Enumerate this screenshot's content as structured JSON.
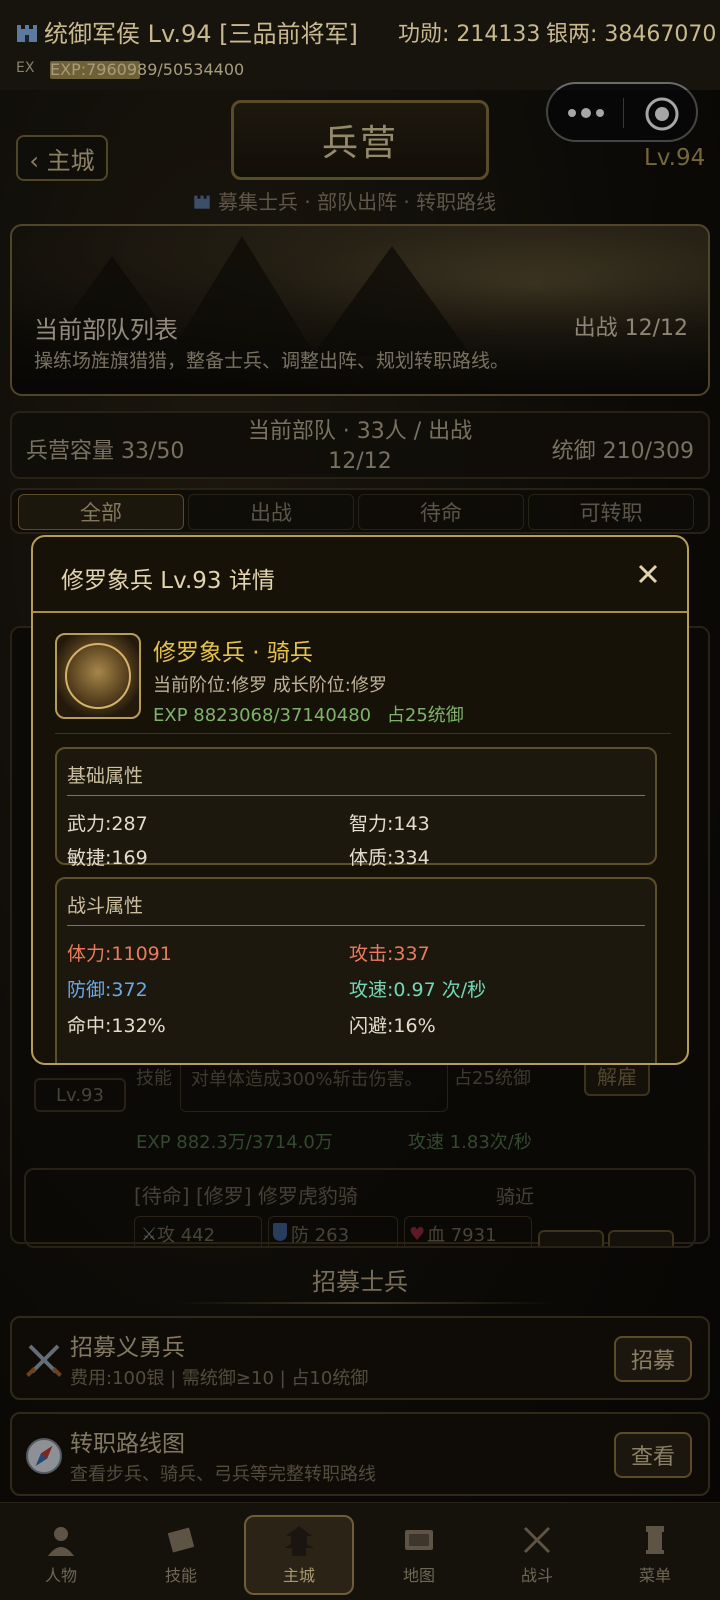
{
  "status": {
    "title": "统御军侯 Lv.94 [三品前将军]",
    "merit": "功勋: 214133",
    "silver": "银两: 38467070",
    "ex_label": "EX",
    "exp_text": "EXP:7960989/50534400",
    "exp_progress": 0.158
  },
  "header": {
    "back_label": "‹ 主城",
    "title": "兵营",
    "level": "Lv.94",
    "subtitle": "募集士兵 · 部队出阵 · 转职路线"
  },
  "banner": {
    "title": "当前部队列表",
    "deploy": "出战 12/12",
    "desc": "操练场旌旗猎猎，整备士兵、调整出阵、规划转职路线。"
  },
  "capacity": {
    "barracks": "兵营容量 33/50",
    "current": "当前部队 · 33人 / 出战12/12",
    "command": "统御 210/309"
  },
  "tabs": [
    "全部",
    "出战",
    "待命",
    "可转职"
  ],
  "list": {
    "card2": {
      "level": "Lv.93",
      "skill_label": "技能",
      "skill_text": "对单体造成300%斩击伤害。",
      "occupy": "占25统御",
      "disband": "解雇",
      "exp": "EXP 882.3万/3714.0万",
      "speed": "攻速 1.83次/秒"
    },
    "card3": {
      "title": "[待命] [修罗] 修罗虎豹骑",
      "role": "骑近",
      "atk": "攻 442",
      "def": "防 263",
      "hp": "血 7931"
    }
  },
  "recruit": {
    "heading": "招募士兵",
    "militia": {
      "title": "招募义勇兵",
      "desc": "费用:100银 | 需统御≥10 | 占10统御",
      "button": "招募"
    },
    "route": {
      "title": "转职路线图",
      "desc": "查看步兵、骑兵、弓兵等完整转职路线",
      "button": "查看"
    }
  },
  "nav": [
    "人物",
    "技能",
    "主城",
    "地图",
    "战斗",
    "菜单"
  ],
  "modal": {
    "title": "修罗象兵 Lv.93 详情",
    "unit_name": "修罗象兵 · 骑兵",
    "tier": "当前阶位:修罗  成长阶位:修罗",
    "exp": "EXP 8823068/37140480",
    "occupy": "占25统御",
    "basic": {
      "header": "基础属性",
      "str": "武力:287",
      "int": "智力:143",
      "agi": "敏捷:169",
      "con": "体质:334"
    },
    "combat": {
      "header": "战斗属性",
      "hp": "体力:11091",
      "atk": "攻击:337",
      "def": "防御:372",
      "spd": "攻速:0.97 次/秒",
      "hit": "命中:132%",
      "dodge": "闪避:16%"
    }
  },
  "colors": {
    "gold": "#e6c24a",
    "exp_green": "#7fb36a",
    "red": "#ea7a5c",
    "blue": "#6aa8e6",
    "teal": "#74d6b8",
    "border_gold": "#b79d5a"
  }
}
